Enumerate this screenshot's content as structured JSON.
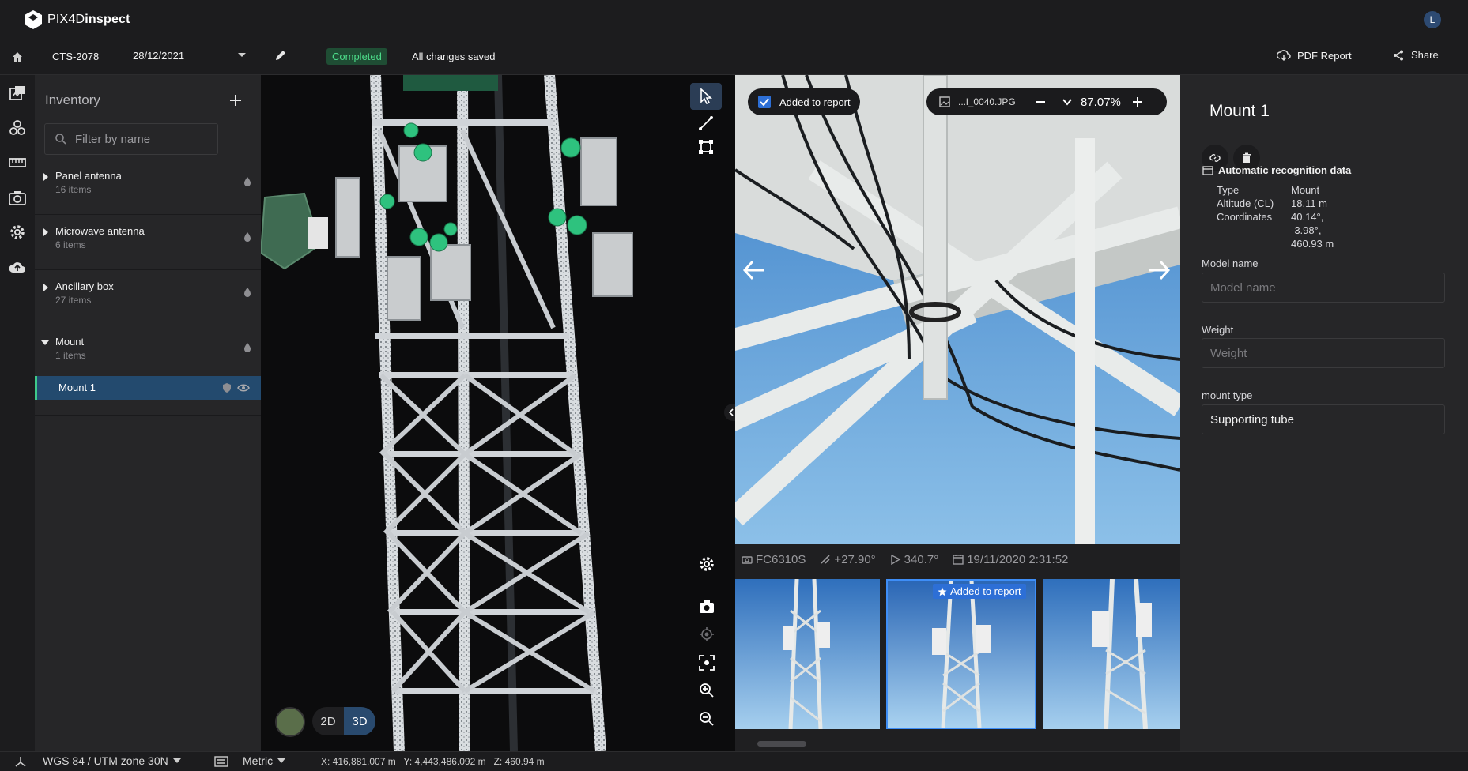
{
  "app": {
    "brand_prefix": "PIX4D",
    "brand_suffix": "inspect",
    "user_initial": "L"
  },
  "project": {
    "id": "CTS-2078",
    "date": "28/12/2021",
    "status": "Completed",
    "save_state": "All changes saved"
  },
  "actions": {
    "pdf_report": "PDF Report",
    "share": "Share"
  },
  "inventory": {
    "title": "Inventory",
    "filter_placeholder": "Filter by name",
    "categories": [
      {
        "name": "Panel antenna",
        "count": "16 items",
        "expanded": false
      },
      {
        "name": "Microwave antenna",
        "count": "6 items",
        "expanded": false
      },
      {
        "name": "Ancillary box",
        "count": "27 items",
        "expanded": false
      },
      {
        "name": "Mount",
        "count": "1 items",
        "expanded": true
      }
    ],
    "selected_item": "Mount 1"
  },
  "viewer": {
    "mode_2d": "2D",
    "mode_3d": "3D",
    "active_mode": "3D"
  },
  "photo": {
    "added_label": "Added to report",
    "filename": "...l_0040.JPG",
    "zoom": "87.07%",
    "camera": "FC6310S",
    "pitch": "+27.90°",
    "heading": "340.7°",
    "datetime": "19/11/2020 2:31:52",
    "thumb_badge": "Added to report"
  },
  "detail": {
    "title": "Mount 1",
    "section": "Automatic recognition data",
    "type_label": "Type",
    "type_value": "Mount",
    "alt_label": "Altitude (CL)",
    "alt_value": "18.11 m",
    "coord_label": "Coordinates",
    "coord_lat": "40.14°,",
    "coord_lon": "-3.98°,",
    "coord_alt": "460.93 m",
    "model_name_label": "Model name",
    "model_name_placeholder": "Model name",
    "weight_label": "Weight",
    "weight_placeholder": "Weight",
    "mount_type_label": "mount type",
    "mount_type_value": "Supporting tube"
  },
  "status_bar": {
    "crs": "WGS 84 / UTM zone 30N",
    "units": "Metric",
    "coords": "X: 416,881.007 m   Y: 4,443,486.092 m   Z: 460.94 m"
  },
  "colors": {
    "accent": "#294a6e",
    "success": "#4ddc8a",
    "selected_border": "#3ec98a"
  }
}
